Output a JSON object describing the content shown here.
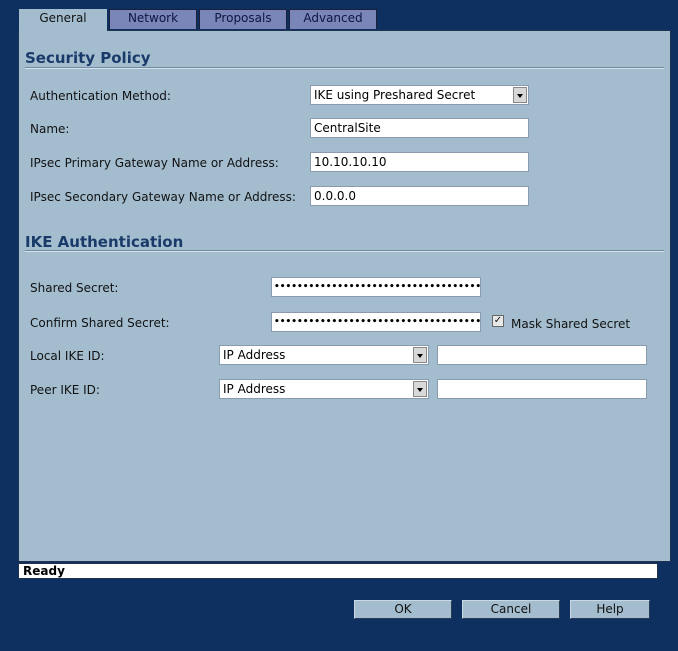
{
  "tabs": [
    {
      "label": "General",
      "active": true
    },
    {
      "label": "Network",
      "active": false
    },
    {
      "label": "Proposals",
      "active": false
    },
    {
      "label": "Advanced",
      "active": false
    }
  ],
  "security_policy": {
    "title": "Security Policy",
    "auth_method": {
      "label": "Authentication Method:",
      "value": "IKE using Preshared Secret"
    },
    "name": {
      "label": "Name:",
      "value": "CentralSite"
    },
    "primary_gateway": {
      "label": "IPsec Primary Gateway Name or Address:",
      "value": "10.10.10.10"
    },
    "secondary_gateway": {
      "label": "IPsec Secondary Gateway Name or Address:",
      "value": "0.0.0.0"
    }
  },
  "ike_auth": {
    "title": "IKE Authentication",
    "shared_secret": {
      "label": "Shared Secret:",
      "masked_value": "••••••••••••••••••••••••••••••••••••••••"
    },
    "confirm_secret": {
      "label": "Confirm Shared Secret:",
      "masked_value": "••••••••••••••••••••••••••••••••••••••••"
    },
    "mask_checkbox": {
      "label": "Mask Shared Secret",
      "checked": true
    },
    "local_ike_id": {
      "label": "Local IKE ID:",
      "type_value": "IP Address",
      "value": ""
    },
    "peer_ike_id": {
      "label": "Peer IKE ID:",
      "type_value": "IP Address",
      "value": ""
    }
  },
  "status": {
    "text": "Ready"
  },
  "buttons": {
    "ok": "OK",
    "cancel": "Cancel",
    "help": "Help"
  },
  "colors": {
    "background": "#0d3060",
    "panel": "#a3bdcf",
    "tab_inactive": "#7a86b8",
    "heading": "#1a3a6a"
  }
}
